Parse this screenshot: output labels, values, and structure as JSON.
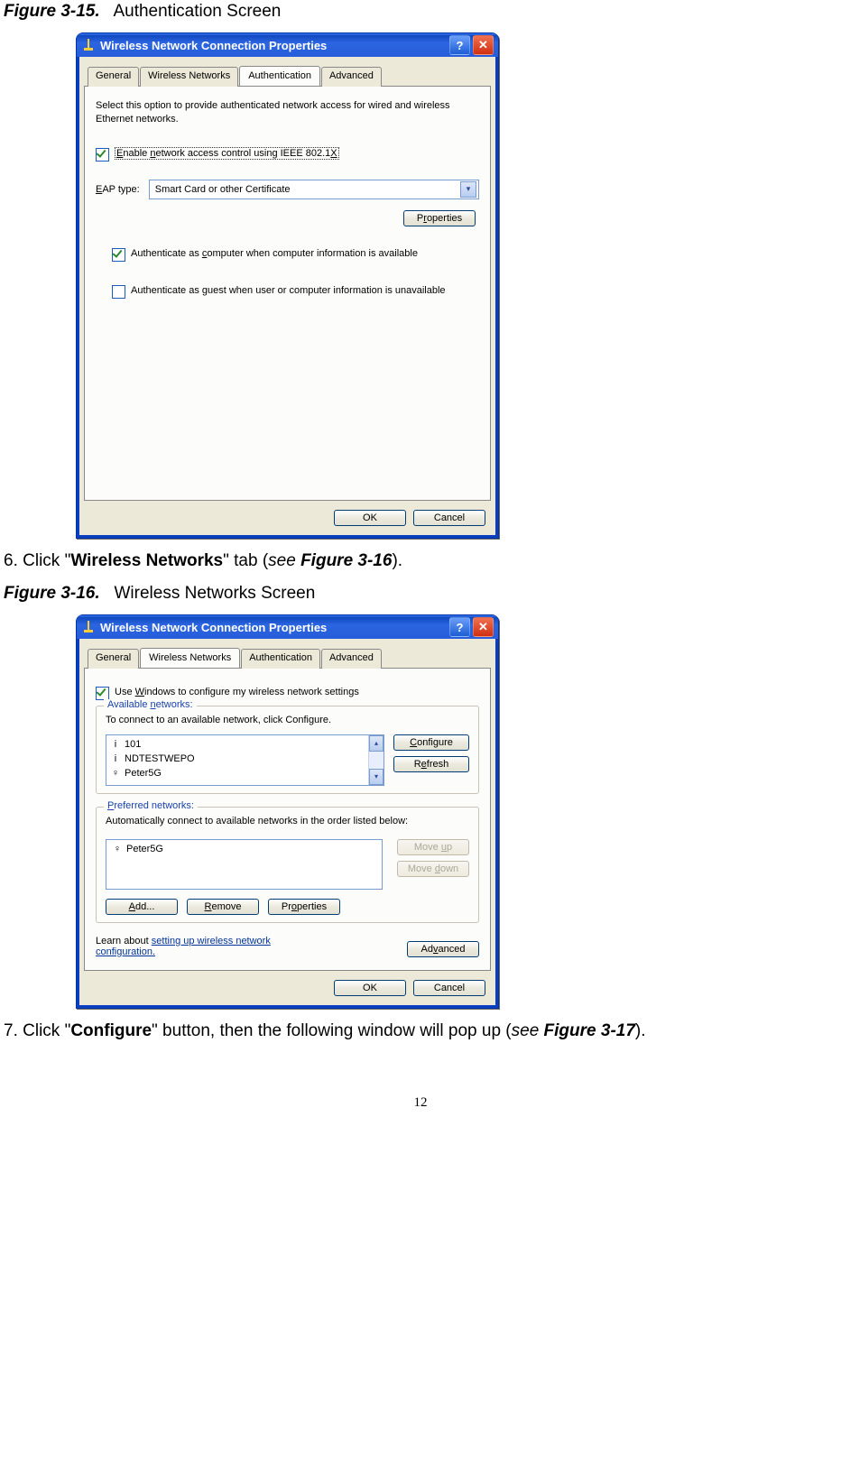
{
  "fig1": {
    "label_num": "Figure 3-15.",
    "label_title": "Authentication Screen",
    "window_title": "Wireless Network Connection Properties",
    "tabs": [
      "General",
      "Wireless Networks",
      "Authentication",
      "Advanced"
    ],
    "active_tab_index": 2,
    "desc": "Select this option to provide authenticated network access for wired and wireless Ethernet networks.",
    "enable_cb_label": "Enable network access control using IEEE 802.1X",
    "enable_cb_checked": true,
    "eap_label": "EAP type:",
    "eap_value": "Smart Card or other Certificate",
    "properties_btn": "Properties",
    "auth_computer_label": "Authenticate as computer when computer information is available",
    "auth_computer_checked": true,
    "auth_guest_label": "Authenticate as guest when user or computer information is unavailable",
    "auth_guest_checked": false,
    "ok": "OK",
    "cancel": "Cancel"
  },
  "step6": {
    "text_prefix": "6. Click \"",
    "bold_part": "Wireless Networks",
    "text_after_bold": "\" tab (",
    "see_word": "see ",
    "fig_ref": "Figure 3-16",
    "text_end": ")."
  },
  "fig2": {
    "label_num": "Figure 3-16.",
    "label_title": "Wireless Networks Screen",
    "window_title": "Wireless Network Connection Properties",
    "tabs": [
      "General",
      "Wireless Networks",
      "Authentication",
      "Advanced"
    ],
    "active_tab_index": 1,
    "use_windows_label": "Use Windows to configure my wireless network settings",
    "use_windows_checked": true,
    "available_legend": "Available networks:",
    "available_desc": "To connect to an available network, click Configure.",
    "available_items": [
      "101",
      "NDTESTWEPO",
      "Peter5G"
    ],
    "configure_btn": "Configure",
    "refresh_btn": "Refresh",
    "preferred_legend": "Preferred networks:",
    "preferred_desc": "Automatically connect to available networks in the order listed below:",
    "preferred_items": [
      "Peter5G"
    ],
    "move_up": "Move up",
    "move_down": "Move down",
    "add": "Add...",
    "remove": "Remove",
    "properties": "Properties",
    "learn_prefix": "Learn about ",
    "learn_link": "setting up wireless network configuration.",
    "advanced_btn": "Advanced",
    "ok": "OK",
    "cancel": "Cancel"
  },
  "step7": {
    "text_prefix": "7. Click \"",
    "bold_part": "Configure",
    "text_after_bold": "\" button, then the following window will pop up (",
    "see_word": "see ",
    "fig_ref": "Figure 3-17",
    "text_end": ")."
  },
  "page_number": "12"
}
